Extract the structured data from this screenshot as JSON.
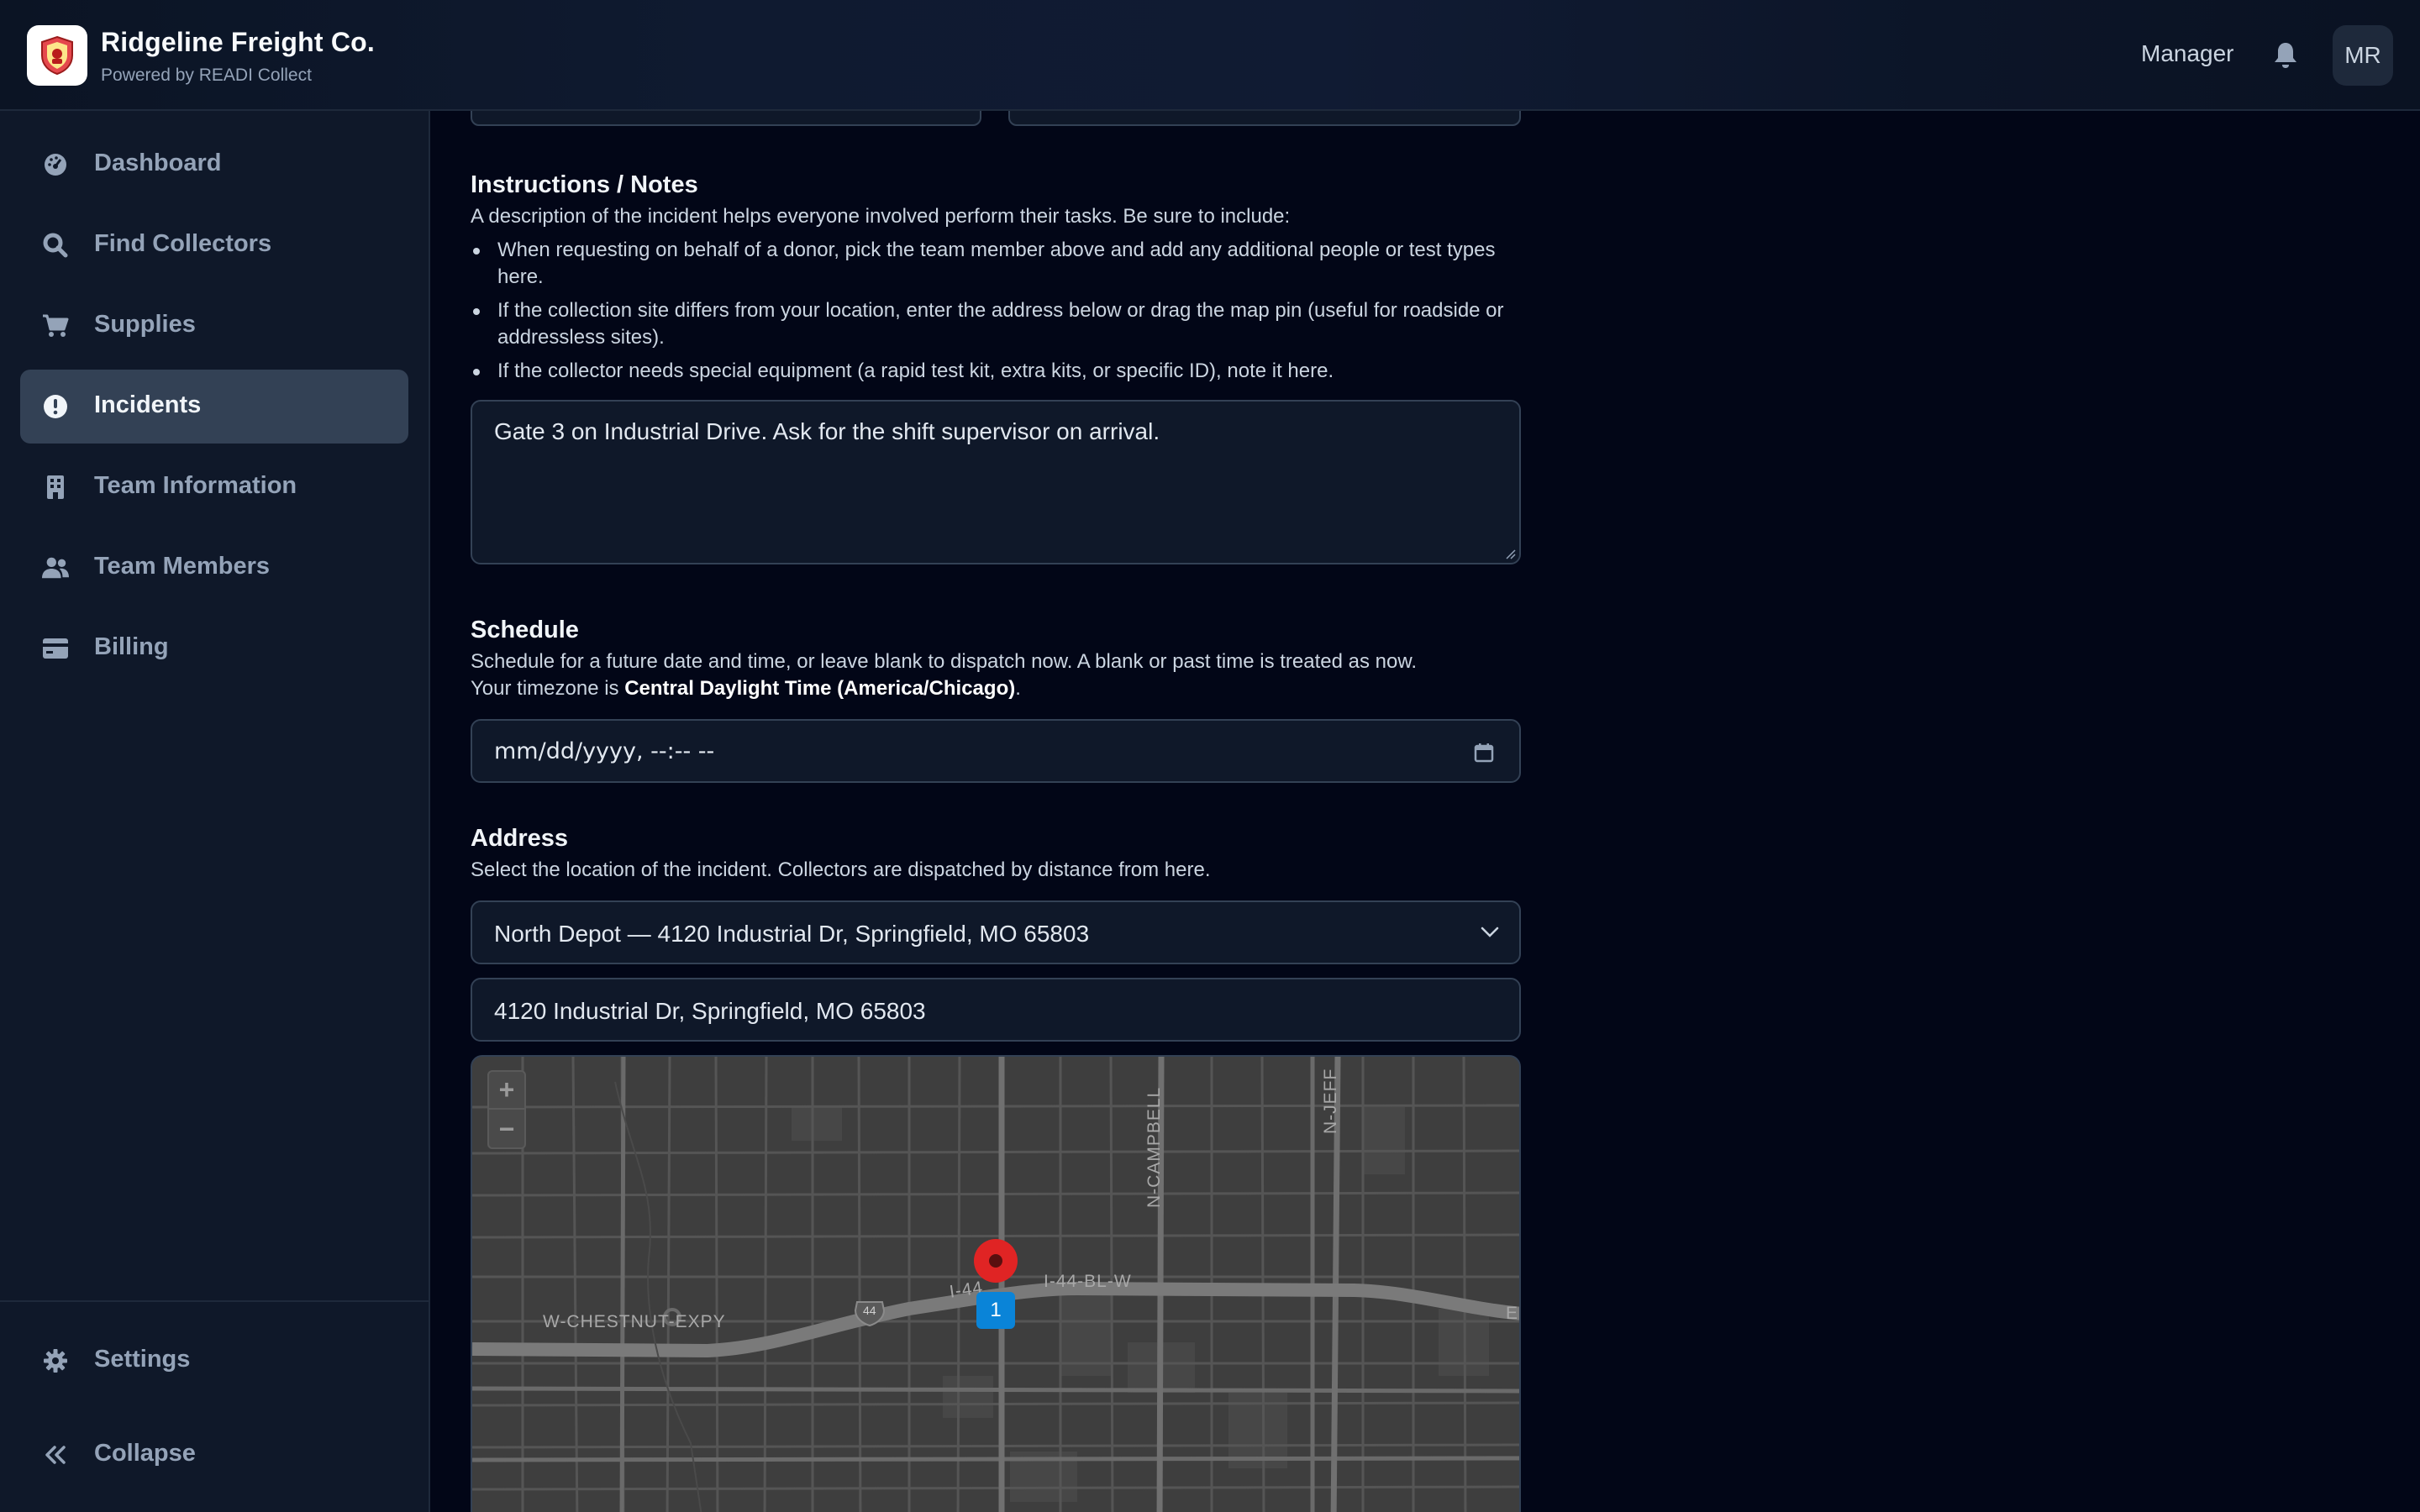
{
  "header": {
    "company_name": "Ridgeline Freight Co.",
    "powered_by": "Powered by READI Collect",
    "role": "Manager",
    "avatar_initials": "MR"
  },
  "sidebar": {
    "items": [
      {
        "label": "Dashboard",
        "icon": "dashboard-icon",
        "active": false
      },
      {
        "label": "Find Collectors",
        "icon": "search-icon",
        "active": false
      },
      {
        "label": "Supplies",
        "icon": "cart-icon",
        "active": false
      },
      {
        "label": "Incidents",
        "icon": "alert-circle-icon",
        "active": true
      },
      {
        "label": "Team Information",
        "icon": "building-icon",
        "active": false
      },
      {
        "label": "Team Members",
        "icon": "users-icon",
        "active": false
      },
      {
        "label": "Billing",
        "icon": "credit-card-icon",
        "active": false
      }
    ],
    "settings_label": "Settings",
    "collapse_label": "Collapse"
  },
  "notes": {
    "title": "Instructions / Notes",
    "intro": "A description of the incident helps everyone involved perform their tasks. Be sure to include:",
    "bullets": [
      "When requesting on behalf of a donor, pick the team member above and add any additional people or test types here.",
      "If the collection site differs from your location, enter the address below or drag the map pin (useful for roadside or addressless sites).",
      "If the collector needs special equipment (a rapid test kit, extra kits, or specific ID), note it here."
    ],
    "value": "Gate 3 on Industrial Drive. Ask for the shift supervisor on arrival."
  },
  "schedule": {
    "title": "Schedule",
    "line1": "Schedule for a future date and time, or leave blank to dispatch now. A blank or past time is treated as now.",
    "tz_prefix": "Your timezone is ",
    "tz_name": "Central Daylight Time (America/Chicago)",
    "tz_suffix": ".",
    "placeholder": "mm/dd/yyyy, --:-- --"
  },
  "address": {
    "title": "Address",
    "description": "Select the location of the incident. Collectors are dispatched by distance from here.",
    "selected_location": "North Depot — 4120 Industrial Dr, Springfield, MO 65803",
    "address_value": "4120 Industrial Dr, Springfield, MO 65803"
  },
  "map": {
    "zoom_in": "+",
    "zoom_out": "−",
    "pin_count": "1",
    "labels": {
      "chestnut": "W-CHESTNUT-EXPY",
      "campbell": "N-CAMPBELL",
      "jefferson": "N-JEFF",
      "i44bl": "I-44-BL-W",
      "i44": "I-44",
      "e": "E",
      "shield": "44"
    }
  },
  "colors": {
    "accent_active": "#334155",
    "pin_red": "#e02424",
    "pin_blue": "#0a84d8"
  }
}
